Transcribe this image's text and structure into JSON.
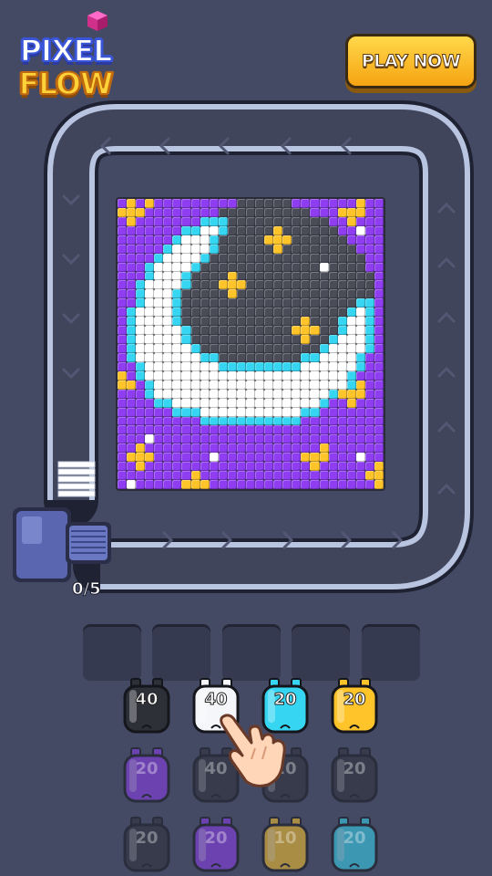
{
  "logo": {
    "line1": "PIXEL",
    "line2": "FLOW"
  },
  "play_button": {
    "label": "PLAY NOW"
  },
  "counter": {
    "text": "0/5"
  },
  "colors": {
    "background": "#444a64",
    "track": "#b8c4e0",
    "play_button": "#ffc62a"
  },
  "palette": {
    "P": "#8e3df0",
    "p": "#6a2ad0",
    "Y": "#ffc42a",
    "W": "#ffffff",
    "w": "#e4e8f4",
    "C": "#36d6f2",
    "K": "#2c2e38",
    "G": "#4a4c58"
  },
  "pixel_art": [
    "PYPYPPPPPPPPPGGGGGGPPPPPPPYPP",
    "YYYPPPPPPPPGGGGGGGGGGPPPYYYPP",
    "PYPPPPPPPCCCGGGGGGGGGGGPPYPPP",
    "PPPPPPPCCWWCGGGGGYGGGGGGPPWPP",
    "PPPPPPCWWWCGGGGGYYYGGGGGGPPPP",
    "PPPPPCWWWWCGGGGGGYGGGGGGGGPPP",
    "PPPPCWWWWCGGGGGGGGGGGGGGGGGPP",
    "PPPCWWWWCGGGGGGGGGGGGGWGGGGPP",
    "PPPCWWWCGGGGYGGGGGGGGGGGGGGGP",
    "PPCWWWWCGGGYYYGGGGGGGGGGGGGGP",
    "PPCWWWCGGGGGYGGGGGGGGGGGGGGGP",
    "PPCWWWCGGGGGGGGGGGGGGGGGGGCCP",
    "PCWWWWCGGGGGGGGGGGGGGGGGGCWCP",
    "PCWWWWCGGGGGGGGGGGGGYGGGCWWCP",
    "PCWWWWWCGGGGGGGGGGGYYYGGCWWCP",
    "PCWWWWWCGGGGGGGGGGGGYGGCWWWCP",
    "PCWWWWWWCGGGGGGGGGGGGGCWWWWCP",
    "PCWWWWWWWCCGGGGGGGGGCCWWWWCPP",
    "PPCWWWWWWWWCCCCCCCCCWWWWWWCPP",
    "YPCWWWWWWWWWWWWWWWWWWWWWWCPPP",
    "YYPCWWWWWWWWWWWWWWWWWWWWWCYPP",
    "PPPCWWWWWWWWWWWWWWWWWWWCYYYPP",
    "PPPPCCWWWWWWWWWWWWWWWWCPPYPPP",
    "PPPPPPCCCWWWWWWWWWWWCCPPPPPPP",
    "PPPPPPPPPCCCCCCCCCCCPPPPPPPPP",
    "PPPPPPPPPPPPPPPPPPPPPPPPPPPPP",
    "PPPWPPPPPPPPPPPPPPPPPPPPPPPPP",
    "PPYPPPPPPPPPPPPPPPPPPPYPPPPPP",
    "PYYYPPPPPPWPPPPPPPPPYYYPPPWPP",
    "PPYPPPPPPPPPPPPPPPPPPYPPPPPPY",
    "PPPPPPPPYPPPPPPPPPPPPPPPPPPYY",
    "PWPPPPPYYYPPPPPPPPPPPPPPPPPPY"
  ],
  "slots": [
    "",
    "",
    "",
    "",
    ""
  ],
  "bottles": [
    {
      "label": "40",
      "color": "#2e3038",
      "dim": false
    },
    {
      "label": "40",
      "color": "#f4f6fa",
      "dim": false
    },
    {
      "label": "20",
      "color": "#36d6f2",
      "dim": false
    },
    {
      "label": "20",
      "color": "#ffc42a",
      "dim": false
    },
    {
      "label": "20",
      "color": "#8e3df0",
      "dim": true
    },
    {
      "label": "40",
      "color": "#2e3038",
      "dim": true
    },
    {
      "label": "20",
      "color": "#2e3038",
      "dim": true
    },
    {
      "label": "20",
      "color": "#2e3038",
      "dim": true
    },
    {
      "label": "20",
      "color": "#2e3038",
      "dim": true
    },
    {
      "label": "20",
      "color": "#8e3df0",
      "dim": true
    },
    {
      "label": "10",
      "color": "#ffc42a",
      "dim": true
    },
    {
      "label": "20",
      "color": "#36d6f2",
      "dim": true
    }
  ]
}
